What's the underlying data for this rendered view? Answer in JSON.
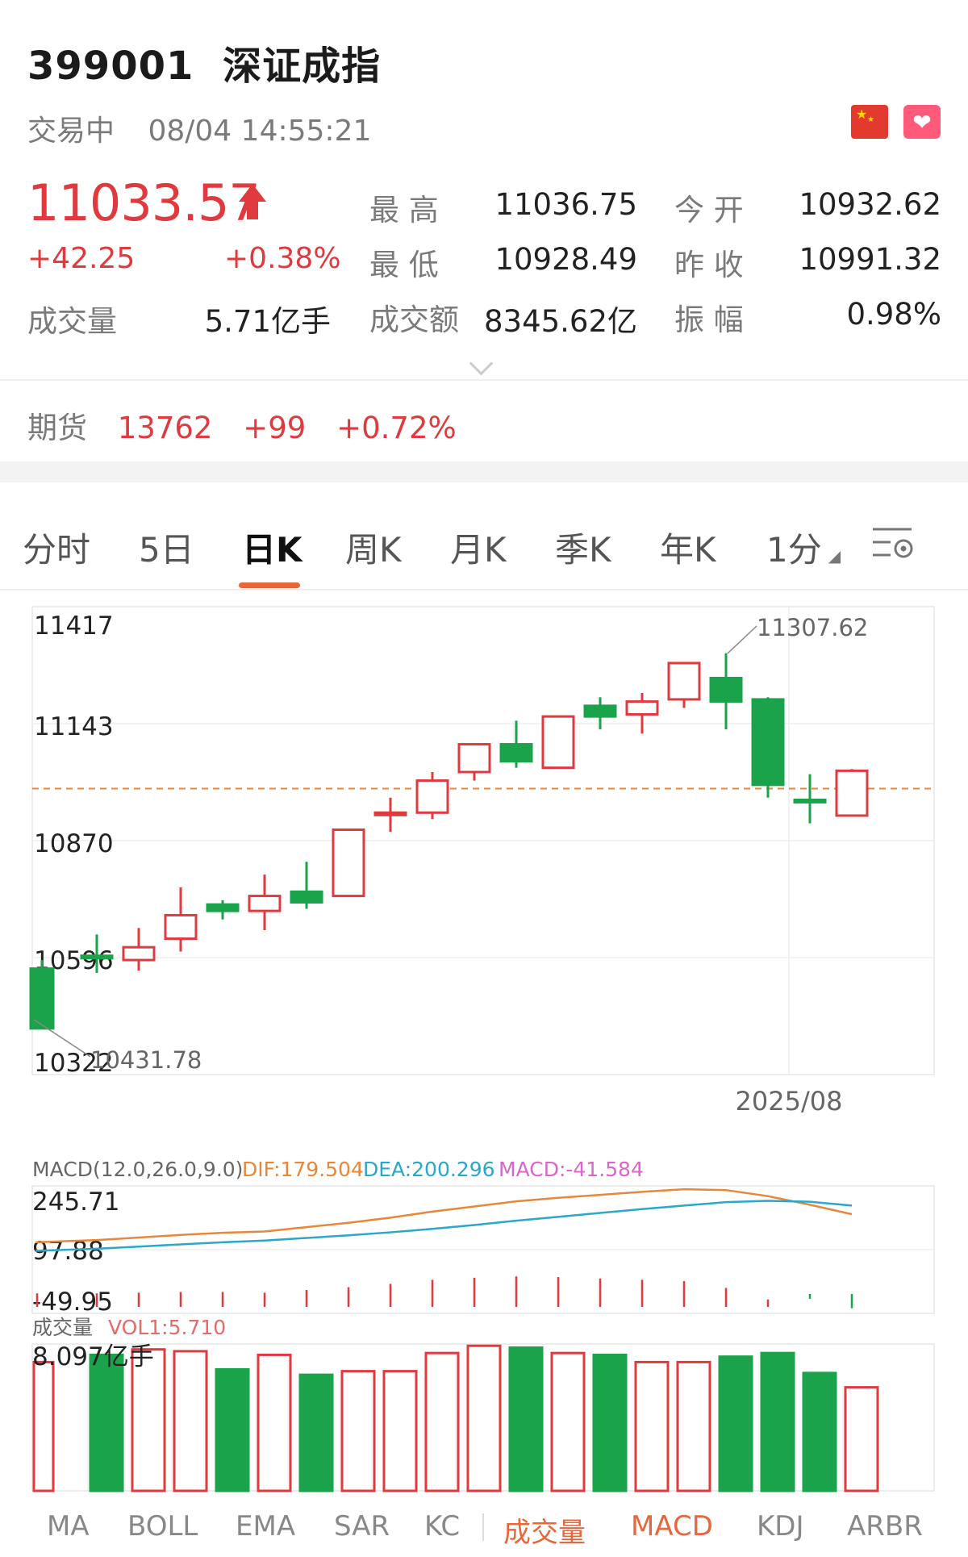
{
  "header": {
    "code": "399001",
    "name": "深证成指",
    "status": "交易中",
    "datetime": "08/04 14:55:21"
  },
  "icons": {
    "flag": "china-flag-icon",
    "favorite": "heart-icon",
    "settings": "settings-gear-icon",
    "expand": "chevron-down-icon"
  },
  "colors": {
    "up": "#e0393e",
    "down": "#1aa34a",
    "accent": "#e8673a",
    "dea": "#2aa7c9",
    "macd": "#d966c8"
  },
  "quote": {
    "price": "11033.57",
    "change": "+42.25",
    "change_pct": "+0.38%",
    "volume_label": "成交量",
    "volume": "5.71亿手",
    "high_label": "最 高",
    "high": "11036.75",
    "low_label": "最 低",
    "low": "10928.49",
    "amount_label": "成交额",
    "amount": "8345.62亿",
    "open_label": "今 开",
    "open": "10932.62",
    "prev_close_label": "昨 收",
    "prev_close": "10991.32",
    "amplitude_label": "振 幅",
    "amplitude": "0.98%"
  },
  "futures": {
    "label": "期货",
    "price": "13762",
    "change": "+99",
    "change_pct": "+0.72%"
  },
  "tabs": [
    {
      "label": "分时"
    },
    {
      "label": "5日"
    },
    {
      "label": "日K",
      "active": true
    },
    {
      "label": "周K"
    },
    {
      "label": "月K"
    },
    {
      "label": "季K"
    },
    {
      "label": "年K"
    },
    {
      "label": "1分"
    }
  ],
  "chart_data": [
    {
      "type": "candlestick",
      "y_ticks": [
        "11417",
        "11143",
        "10870",
        "10596",
        "10322"
      ],
      "ylim": [
        10322,
        11417
      ],
      "x_label": "2025/08",
      "max_annotation": "11307.62",
      "min_annotation": "10431.78",
      "reference_line": 10991.32,
      "candles": [
        {
          "o": 10570,
          "c": 10430,
          "h": 10590,
          "l": 10432
        },
        {
          "o": 10600,
          "c": 10598,
          "h": 10650,
          "l": 10560
        },
        {
          "o": 10590,
          "c": 10620,
          "h": 10665,
          "l": 10565
        },
        {
          "o": 10640,
          "c": 10695,
          "h": 10760,
          "l": 10610
        },
        {
          "o": 10720,
          "c": 10705,
          "h": 10730,
          "l": 10685
        },
        {
          "o": 10705,
          "c": 10740,
          "h": 10790,
          "l": 10660
        },
        {
          "o": 10750,
          "c": 10725,
          "h": 10820,
          "l": 10710
        },
        {
          "o": 10740,
          "c": 10895,
          "h": 10895,
          "l": 10740
        },
        {
          "o": 10930,
          "c": 10935,
          "h": 10970,
          "l": 10890
        },
        {
          "o": 10935,
          "c": 11010,
          "h": 11030,
          "l": 10920
        },
        {
          "o": 11030,
          "c": 11095,
          "h": 11095,
          "l": 11010
        },
        {
          "o": 11095,
          "c": 11055,
          "h": 11150,
          "l": 11040
        },
        {
          "o": 11040,
          "c": 11160,
          "h": 11160,
          "l": 11040
        },
        {
          "o": 11185,
          "c": 11160,
          "h": 11205,
          "l": 11130
        },
        {
          "o": 11165,
          "c": 11195,
          "h": 11215,
          "l": 11120
        },
        {
          "o": 11200,
          "c": 11285,
          "h": 11285,
          "l": 11180
        },
        {
          "o": 11250,
          "c": 11195,
          "h": 11308,
          "l": 11130
        },
        {
          "o": 11200,
          "c": 11000,
          "h": 11205,
          "l": 10970
        },
        {
          "o": 10965,
          "c": 10963,
          "h": 11025,
          "l": 10910
        },
        {
          "o": 10928,
          "c": 11033,
          "h": 11037,
          "l": 10928
        }
      ]
    },
    {
      "type": "line",
      "title": "MACD(12.0,26.0,9.0)",
      "dif_label": "DIF:179.504",
      "dea_label": "DEA:200.296",
      "macd_label": "MACD:-41.584",
      "y_ticks": [
        "245.71",
        "97.88",
        "-49.95"
      ],
      "ylim": [
        -49.95,
        245.71
      ],
      "series": [
        {
          "name": "DIF",
          "values": [
            115,
            120,
            126,
            132,
            137,
            140,
            150,
            160,
            172,
            186,
            198,
            210,
            218,
            225,
            232,
            238,
            236,
            222,
            202,
            180
          ]
        },
        {
          "name": "DEA",
          "values": [
            95,
            100,
            105,
            110,
            115,
            119,
            125,
            131,
            138,
            146,
            155,
            165,
            174,
            183,
            192,
            200,
            208,
            211,
            209,
            200
          ]
        },
        {
          "name": "MACD",
          "values": [
            40,
            40,
            42,
            44,
            44,
            42,
            50,
            58,
            68,
            80,
            86,
            90,
            88,
            84,
            80,
            76,
            56,
            22,
            -14,
            -42
          ]
        }
      ]
    },
    {
      "type": "bar",
      "title": "成交量",
      "vol_label": "VOL1:5.710",
      "y_max_label": "8.097亿手",
      "ylim": [
        0,
        8.097
      ],
      "values": [
        7.1,
        7.5,
        7.8,
        7.7,
        6.7,
        7.5,
        6.4,
        6.6,
        6.6,
        7.6,
        8.0,
        7.9,
        7.6,
        7.5,
        7.1,
        7.1,
        7.4,
        7.6,
        6.5,
        5.71
      ],
      "up": [
        true,
        false,
        true,
        true,
        false,
        true,
        false,
        true,
        true,
        true,
        true,
        false,
        true,
        false,
        true,
        true,
        false,
        false,
        false,
        true
      ]
    }
  ],
  "indicators": [
    {
      "label": "MA"
    },
    {
      "label": "BOLL"
    },
    {
      "label": "EMA"
    },
    {
      "label": "SAR"
    },
    {
      "label": "KC"
    },
    {
      "label": "成交量",
      "active": true
    },
    {
      "label": "MACD",
      "active": true
    },
    {
      "label": "KDJ"
    },
    {
      "label": "ARBR"
    }
  ]
}
